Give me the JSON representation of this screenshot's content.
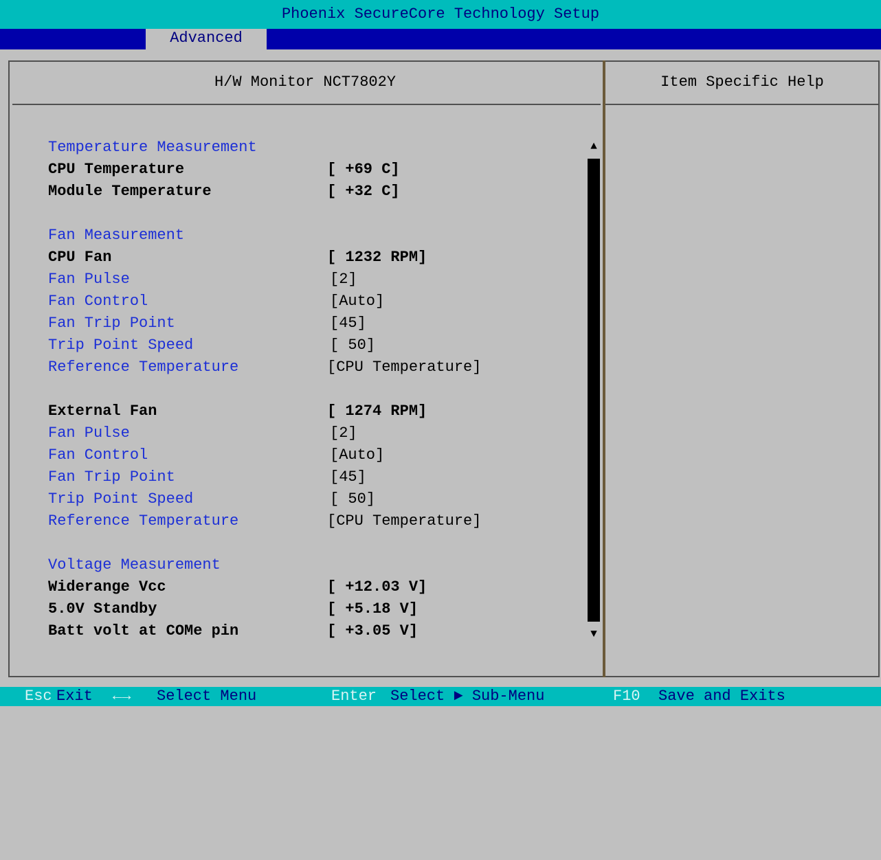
{
  "app_title": "Phoenix SecureCore Technology Setup",
  "menu": {
    "active_tab": "Advanced"
  },
  "panel": {
    "title": "H/W Monitor NCT7802Y"
  },
  "help": {
    "title": "Item Specific Help"
  },
  "sections": {
    "temperature": {
      "heading": "Temperature Measurement",
      "cpu_temp": {
        "label": "CPU Temperature",
        "value": "[ +69 C]"
      },
      "module_temp": {
        "label": "Module Temperature",
        "value": "[ +32 C]"
      }
    },
    "fan": {
      "heading": "Fan Measurement",
      "cpu_fan": {
        "label": "CPU Fan",
        "value": "[ 1232 RPM]",
        "pulse": {
          "label": "Fan Pulse",
          "value": "[2]"
        },
        "control": {
          "label": "Fan Control",
          "value": "[Auto]"
        },
        "trip_point": {
          "label": "Fan Trip Point",
          "value": "[45]"
        },
        "trip_speed": {
          "label": "Trip Point Speed",
          "value": "[ 50]"
        },
        "ref_temp": {
          "label": "Reference Temperature",
          "value": "[CPU Temperature]"
        }
      },
      "ext_fan": {
        "label": "External Fan",
        "value": "[ 1274 RPM]",
        "pulse": {
          "label": "Fan Pulse",
          "value": "[2]"
        },
        "control": {
          "label": "Fan Control",
          "value": "[Auto]"
        },
        "trip_point": {
          "label": "Fan Trip Point",
          "value": "[45]"
        },
        "trip_speed": {
          "label": "Trip Point Speed",
          "value": "[ 50]"
        },
        "ref_temp": {
          "label": "Reference Temperature",
          "value": "[CPU Temperature]"
        }
      }
    },
    "voltage": {
      "heading": "Voltage Measurement",
      "widerange": {
        "label": "Widerange Vcc",
        "value": "[ +12.03 V]"
      },
      "standby": {
        "label": "5.0V Standby",
        "value": "[ +5.18 V]"
      },
      "batt": {
        "label": "Batt volt at COMe pin",
        "value": "[ +3.05 V]"
      }
    }
  },
  "scroll": {
    "up_icon": "▲",
    "down_icon": "▼"
  },
  "footer": {
    "esc_key": "Esc",
    "esc_text": "Exit",
    "arrows_key": "←→",
    "arrows_text": "Select Menu",
    "enter_key": "Enter",
    "enter_text": "Select ► Sub-Menu",
    "f10_key": "F10",
    "f10_text": "Save and Exits"
  }
}
